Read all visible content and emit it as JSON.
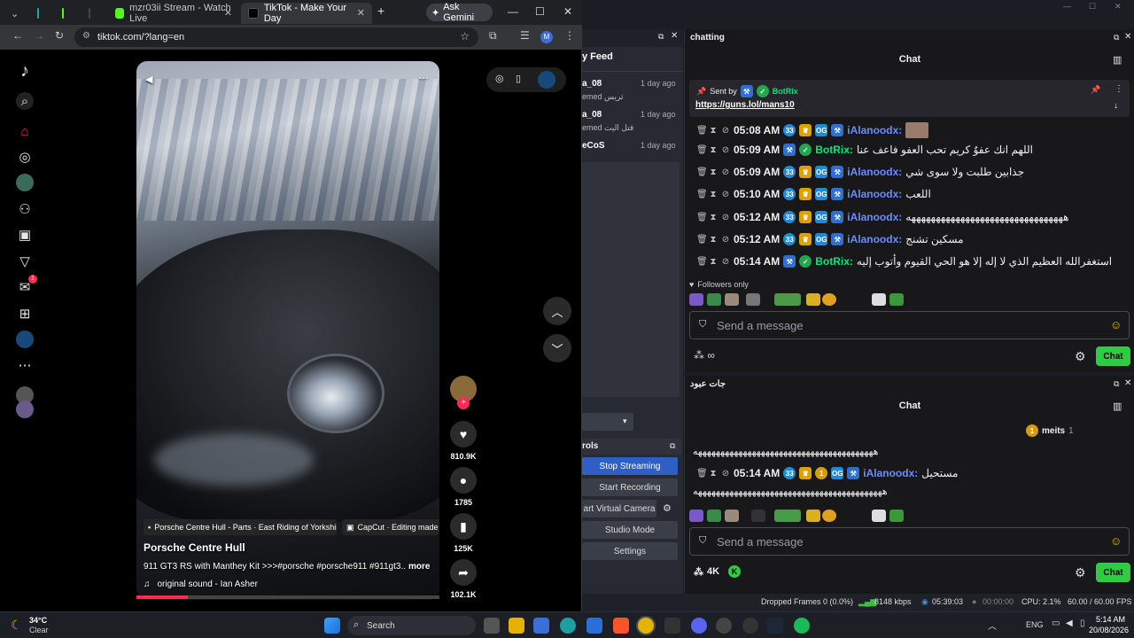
{
  "browser": {
    "tabs": [
      {
        "label": "mzr03ii Stream - Watch Live"
      },
      {
        "label": "TikTok - Make Your Day"
      }
    ],
    "ask_gemini": "Ask Gemini",
    "url": "tiktok.com/?lang=en",
    "profile_initial": "M"
  },
  "tiktok": {
    "inbox_badge": "1",
    "video": {
      "chip1": "Porsche Centre Hull - Parts · East Riding of Yorkshire",
      "chip2": "CapCut · Editing made",
      "author": "Porsche Centre Hull",
      "caption": "911 GT3 RS with Manthey Kit >>>#porsche #porsche911 #911gt3...",
      "more": "more",
      "sound": "original sound - Ian Asher",
      "progress": 0.17
    },
    "likes": "810.9K",
    "comments": "1785",
    "saves": "125K",
    "shares": "102.1K"
  },
  "obs": {
    "feed_title": "y Feed",
    "feed": [
      {
        "name": "a_08",
        "sub": "emed ثريس",
        "ago": "1 day ago"
      },
      {
        "name": "a_08",
        "sub": "emed قتل اليت",
        "ago": "1 day ago"
      },
      {
        "name": "eCoS",
        "sub": "",
        "ago": "1 day ago"
      }
    ],
    "controls_title": "rols",
    "buttons": [
      "Stop Streaming",
      "Start Recording",
      "art Virtual Camera",
      "Studio Mode",
      "Settings"
    ]
  },
  "chat1": {
    "title": "chatting",
    "header": "Chat",
    "pinned_label": "Sent by",
    "pinned_user": "BotRix",
    "pinned_link": "https://guns.lol/mans10",
    "messages": [
      {
        "time": "05:08 AM",
        "user": "iAlanoodx:",
        "text": "",
        "kind": "a"
      },
      {
        "time": "05:09 AM",
        "user": "BotRix:",
        "text": "اللهم انك عفوٌ كريم تحب العفو فاعف عنا",
        "kind": "b"
      },
      {
        "time": "05:09 AM",
        "user": "iAlanoodx:",
        "text": "جذابين طلبت ولا سوى شي",
        "kind": "a"
      },
      {
        "time": "05:10 AM",
        "user": "iAlanoodx:",
        "text": "اللعب",
        "kind": "a"
      },
      {
        "time": "05:12 AM",
        "user": "iAlanoodx:",
        "text": "ههههههههههههههههههههههههههههههههه",
        "kind": "a"
      },
      {
        "time": "05:12 AM",
        "user": "iAlanoodx:",
        "text": "مسكين تشنج",
        "kind": "a"
      },
      {
        "time": "05:14 AM",
        "user": "BotRix:",
        "text": "استغفرالله العظيم الذي لا إله إلا هو الحي القيوم وأتوب إليه",
        "kind": "b"
      }
    ],
    "followers_only": "Followers only",
    "placeholder": "Send a message",
    "chat_button": "Chat"
  },
  "chat2": {
    "title": "جات عبود",
    "header": "Chat",
    "meits": "meits",
    "meits_count": "1",
    "line_top": "ههههههههههههههههههههههههههههههههههههههههه",
    "message": {
      "time": "05:14 AM",
      "user": "iAlanoodx:",
      "text": "مستحيل"
    },
    "line_bottom": "ههههههههههههههههههههههههههههههههههههههههههه",
    "placeholder": "Send a message",
    "viewers": "4K",
    "chat_button": "Chat"
  },
  "status": {
    "dropped": "Dropped Frames 0 (0.0%)",
    "kbps": "8148 kbps",
    "live": "05:39:03",
    "rec": "00:00:00",
    "cpu": "CPU: 2.1%",
    "fps": "60.00 / 60.00 FPS"
  },
  "taskbar": {
    "weather_temp": "34°C",
    "weather_desc": "Clear",
    "search": "Search",
    "lang": "ENG",
    "time": "5:14 AM",
    "date": "20/08/2026"
  },
  "colors": {
    "accent": "#fe2c55",
    "chat_green": "#2ecc40",
    "obs_blue": "#2f5fc4"
  }
}
